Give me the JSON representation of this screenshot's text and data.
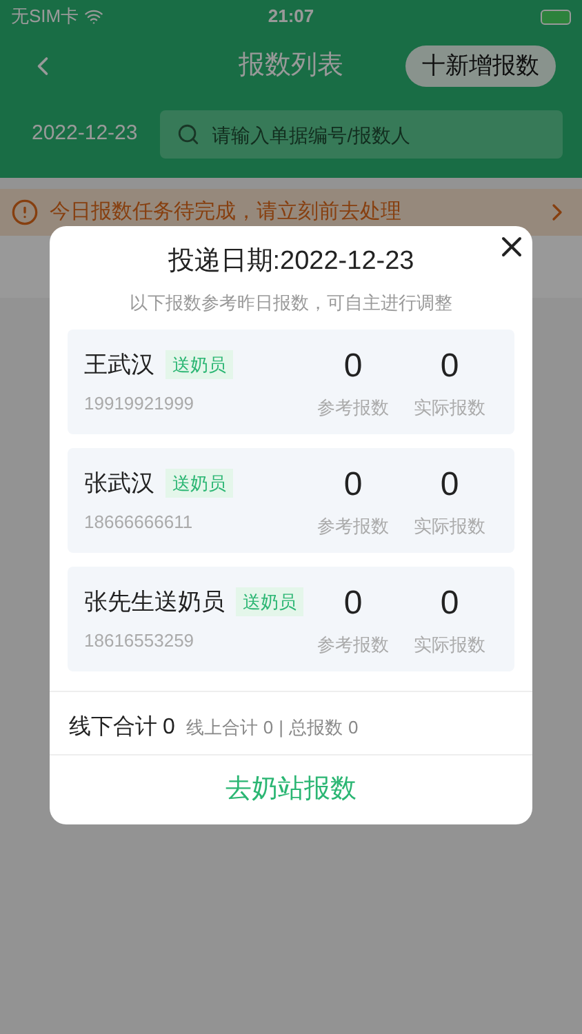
{
  "status_bar": {
    "carrier": "无SIM卡",
    "time": "21:07"
  },
  "header": {
    "title": "报数列表",
    "add_button": "十新增报数"
  },
  "filter": {
    "date": "2022-12-23",
    "search_placeholder": "请输入单据编号/报数人"
  },
  "notice": {
    "text": "今日报数任务待完成，请立刻前去处理"
  },
  "dialog": {
    "title": "投递日期:2022-12-23",
    "subtitle": "以下报数参考昨日报数，可自主进行调整",
    "couriers": [
      {
        "name": "王武汉",
        "role": "送奶员",
        "phone": "19919921999",
        "reference": "0",
        "reference_label": "参考报数",
        "actual": "0",
        "actual_label": "实际报数"
      },
      {
        "name": "张武汉",
        "role": "送奶员",
        "phone": "18666666611",
        "reference": "0",
        "reference_label": "参考报数",
        "actual": "0",
        "actual_label": "实际报数"
      },
      {
        "name": "张先生送奶员",
        "role": "送奶员",
        "phone": "18616553259",
        "reference": "0",
        "reference_label": "参考报数",
        "actual": "0",
        "actual_label": "实际报数"
      }
    ],
    "summary": {
      "offline_label": "线下合计",
      "offline": "0",
      "online_label": "线上合计",
      "online": "0",
      "separator": "|",
      "total_label": "总报数",
      "total": "0"
    },
    "action": "去奶站报数"
  }
}
